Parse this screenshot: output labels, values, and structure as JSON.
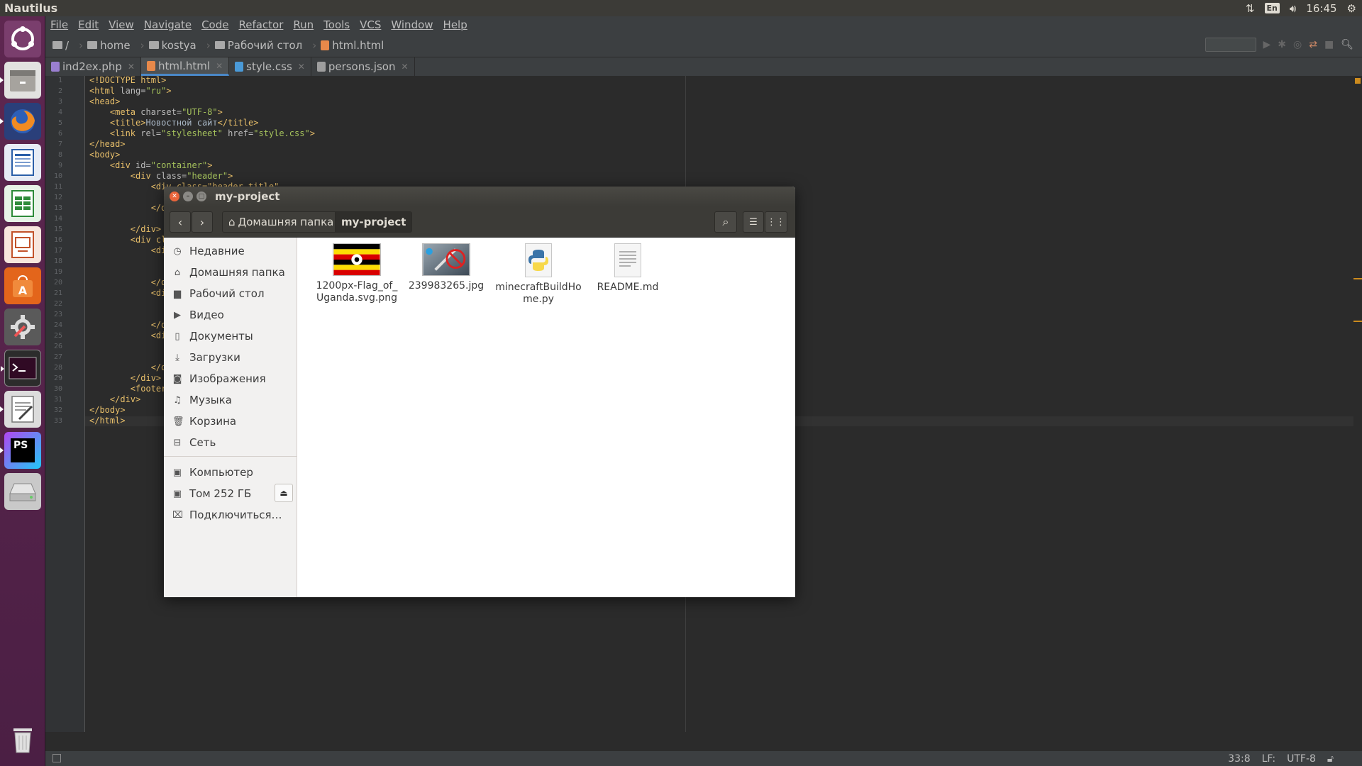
{
  "top_panel": {
    "app_name": "Nautilus",
    "keyboard_layout": "En",
    "time": "16:45",
    "icons": [
      "network-icon",
      "volume-icon",
      "gear-icon"
    ]
  },
  "launcher": {
    "items": [
      "ubuntu-dash-icon",
      "files-icon",
      "firefox-icon",
      "writer-icon",
      "calc-icon",
      "impress-icon",
      "software-center-icon",
      "settings-icon",
      "terminal-icon",
      "text-editor-icon",
      "phpstorm-icon",
      "drive-icon",
      "trash-icon"
    ],
    "phpstorm_label": "PS"
  },
  "ide": {
    "menu": [
      "File",
      "Edit",
      "View",
      "Navigate",
      "Code",
      "Refactor",
      "Run",
      "Tools",
      "VCS",
      "Window",
      "Help"
    ],
    "breadcrumb": [
      "/",
      "home",
      "kostya",
      "Рабочий стол",
      "html.html"
    ],
    "tabs": [
      {
        "label": "ind2ex.php",
        "color": "#9a7fd1"
      },
      {
        "label": "html.html",
        "color": "#e8894a"
      },
      {
        "label": "style.css",
        "color": "#4a9ad8"
      },
      {
        "label": "persons.json",
        "color": "#9e9e9e"
      }
    ],
    "line_numbers": [
      "1",
      "2",
      "3",
      "4",
      "5",
      "6",
      "7",
      "8",
      "9",
      "10",
      "11",
      "12",
      "13",
      "14",
      "15",
      "16",
      "17",
      "18",
      "19",
      "20",
      "21",
      "22",
      "23",
      "24",
      "25",
      "26",
      "27",
      "28",
      "29",
      "30",
      "31",
      "32",
      "33"
    ],
    "code": {
      "l1": "<!DOCTYPE html>",
      "l2a": "<html",
      "l2b": " lang=",
      "l2c": "\"ru\"",
      "l2d": ">",
      "l3": "<head>",
      "l4a": "    <meta",
      "l4b": " charset=",
      "l4c": "\"UTF-8\"",
      "l4d": ">",
      "l5a": "    <title>",
      "l5b": "Новостной сайт",
      "l5c": "</title>",
      "l6a": "    <link",
      "l6b": " rel=",
      "l6c": "\"stylesheet\"",
      "l6d": " href=",
      "l6e": "\"style.css\"",
      "l6f": ">",
      "l7": "</head>",
      "l8": "<body>",
      "l9a": "    <div",
      "l9b": " id=",
      "l9c": "\"container\"",
      "l9d": ">",
      "l10a": "        <div",
      "l10b": " class=",
      "l10c": "\"header\"",
      "l10d": ">",
      "l11": "            <div class=\"header-title\"",
      "l13": "            </d",
      "l15": "        </div>",
      "l16": "        <div cl",
      "l17": "            <di",
      "l20": "            </d",
      "l21": "            <di",
      "l24": "            </d",
      "l25": "            <di",
      "l28": "            </d",
      "l29": "        </div>",
      "l30": "        <footer",
      "l31": "    </div>",
      "l32": "</body>",
      "l33": "</html>"
    },
    "status": {
      "position": "33:8",
      "line_sep": "LF:",
      "encoding": "UTF-8"
    }
  },
  "nautilus": {
    "title": "my-project",
    "path": [
      "Домашняя папка",
      "my-project"
    ],
    "sidebar": [
      {
        "label": "Недавние",
        "icon": "clock-icon"
      },
      {
        "label": "Домашняя папка",
        "icon": "home-icon"
      },
      {
        "label": "Рабочий стол",
        "icon": "folder-icon"
      },
      {
        "label": "Видео",
        "icon": "video-icon"
      },
      {
        "label": "Документы",
        "icon": "document-icon"
      },
      {
        "label": "Загрузки",
        "icon": "download-icon"
      },
      {
        "label": "Изображения",
        "icon": "camera-icon"
      },
      {
        "label": "Музыка",
        "icon": "music-icon"
      },
      {
        "label": "Корзина",
        "icon": "trash-icon"
      },
      {
        "label": "Сеть",
        "icon": "network-icon"
      },
      {
        "label": "Компьютер",
        "icon": "computer-icon"
      },
      {
        "label": "Том 252 ГБ",
        "icon": "drive-icon"
      },
      {
        "label": "Подключиться…",
        "icon": "server-icon"
      }
    ],
    "files": [
      {
        "name": "1200px-Flag_of_Uganda.svg.png",
        "line1": "1200px-Flag_of_",
        "line2": "Uganda.svg.png",
        "kind": "image-flag"
      },
      {
        "name": "239983265.jpg",
        "line1": "239983265.jpg",
        "line2": "",
        "kind": "image-photo"
      },
      {
        "name": "minecraftBuildHome.py",
        "line1": "minecraftBuildHo",
        "line2": "me.py",
        "kind": "python"
      },
      {
        "name": "README.md",
        "line1": "README.md",
        "line2": "",
        "kind": "text"
      }
    ]
  }
}
